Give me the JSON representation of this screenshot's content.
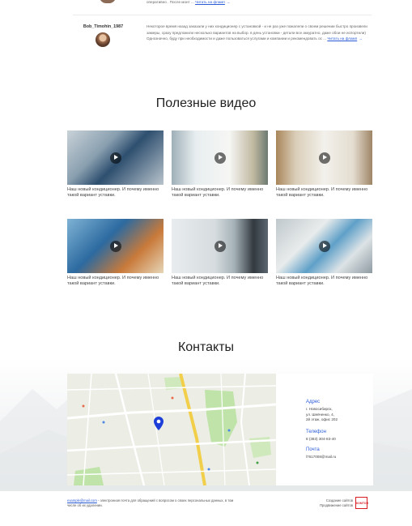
{
  "reviews": [
    {
      "text_tail": "оперативно . После монт ... ",
      "more_label": "Читать на фламп",
      "arrow": "→"
    },
    {
      "author": "Bob_Timohin_1987",
      "text": "Некоторое время назад заказали у них кондиционер с установкой - и не раз уже пожалели о своем решении быстро произвели замеры, сразу предложили несколько вариантов на выбор. в день установки - детали все аккуратно, даже обои не испортили) Однозначно, буду при необходимости и даже пользоваться услугами и компании и рекомендовать ос ... ",
      "more_label": "Читать на фламп",
      "arrow": "→"
    }
  ],
  "videos": {
    "title": "Полезные видео",
    "items": [
      {
        "caption": "Наш новый кондиционер. И почему именно такой вариант уставки."
      },
      {
        "caption": "Наш новый кондиционер. И почему именно такой вариант уставки."
      },
      {
        "caption": "Наш новый кондиционер. И почему именно такой вариант уставки."
      },
      {
        "caption": "Наш новый кондиционер. И почему именно такой вариант уставки."
      },
      {
        "caption": "Наш новый кондиционер. И почему именно такой вариант уставки."
      },
      {
        "caption": "Наш новый кондиционер. И почему именно такой вариант уставки."
      }
    ]
  },
  "contacts": {
    "title": "Контакты",
    "address_label": "Адрес",
    "address_lines": [
      "г. Новосибирск,",
      "ул. Шевченко, 4,",
      "2й этаж, офис 202"
    ],
    "phone_label": "Телефон",
    "phone": "8 (383) 304-83-40",
    "mail_label": "Почта",
    "mail": "l7617008@mail.ru"
  },
  "footer": {
    "email_link": "example@mail.com",
    "text": " - электронная почта для обращений с вопросом о своих персональных данных, в том числе об их удалении.",
    "credits_line1": "Создание сайтов",
    "credits_line2": "Продвижение сайтов",
    "logo_text": "КОМТОН"
  },
  "colors": {
    "accent": "#2a5bd7",
    "map_pin": "#1d3fd8",
    "logo": "#d81b20"
  }
}
